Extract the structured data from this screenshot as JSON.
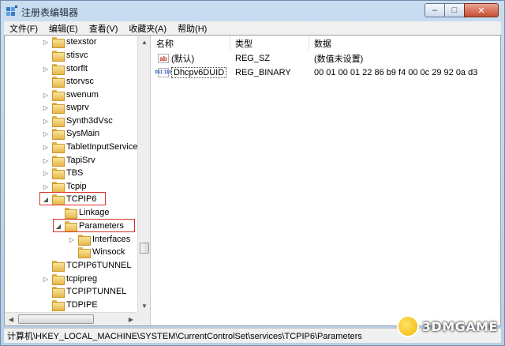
{
  "window": {
    "title": "注册表编辑器",
    "controls": {
      "minimize": "–",
      "maximize": "□",
      "close": "✕"
    }
  },
  "menubar": [
    "文件(F)",
    "编辑(E)",
    "查看(V)",
    "收藏夹(A)",
    "帮助(H)"
  ],
  "tree": [
    {
      "label": "stexstor",
      "expander": "▷"
    },
    {
      "label": "stisvc",
      "expander": ""
    },
    {
      "label": "storflt",
      "expander": "▷"
    },
    {
      "label": "storvsc",
      "expander": ""
    },
    {
      "label": "swenum",
      "expander": "▷"
    },
    {
      "label": "swprv",
      "expander": "▷"
    },
    {
      "label": "Synth3dVsc",
      "expander": "▷"
    },
    {
      "label": "SysMain",
      "expander": "▷"
    },
    {
      "label": "TabletInputService",
      "expander": "▷"
    },
    {
      "label": "TapiSrv",
      "expander": "▷"
    },
    {
      "label": "TBS",
      "expander": "▷"
    },
    {
      "label": "Tcpip",
      "expander": "▷"
    },
    {
      "label": "TCPIP6",
      "expander": "◢"
    },
    {
      "label": "Linkage",
      "expander": ""
    },
    {
      "label": "Parameters",
      "expander": "◢"
    },
    {
      "label": "Interfaces",
      "expander": "▷"
    },
    {
      "label": "Winsock",
      "expander": ""
    },
    {
      "label": "TCPIP6TUNNEL",
      "expander": ""
    },
    {
      "label": "tcpipreg",
      "expander": "▷"
    },
    {
      "label": "TCPIPTUNNEL",
      "expander": ""
    },
    {
      "label": "TDPIPE",
      "expander": ""
    },
    {
      "label": "",
      "expander": ""
    }
  ],
  "list": {
    "columns": [
      "名称",
      "类型",
      "数据"
    ],
    "rows": [
      {
        "icon": "ab",
        "name": "(默认)",
        "type": "REG_SZ",
        "data": "(数值未设置)"
      },
      {
        "icon": "011\n110",
        "name": "Dhcpv6DUID",
        "type": "REG_BINARY",
        "data": "00 01 00 01 22 86 b9 f4 00 0c 29 92 0a d3"
      }
    ]
  },
  "statusbar": {
    "path": "计算机\\HKEY_LOCAL_MACHINE\\SYSTEM\\CurrentControlSet\\services\\TCPIP6\\Parameters"
  },
  "watermark": {
    "text": "3DMGAME"
  },
  "colors": {
    "highlight": "#d9322a",
    "folder": "#e7b74a",
    "titlebar": "#c9dcf0"
  }
}
